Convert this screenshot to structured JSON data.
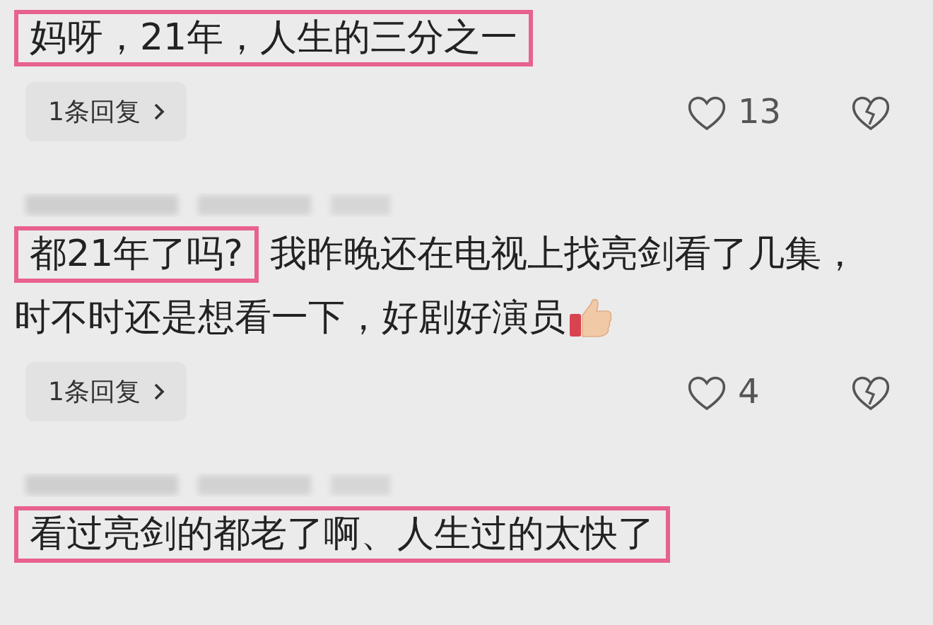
{
  "comments": [
    {
      "author_blurred": false,
      "segments": [
        {
          "text": "妈呀，21年，人生的三分之一",
          "highlighted": true
        }
      ],
      "replies": "1条回复",
      "likes": "13"
    },
    {
      "author_blurred": true,
      "segments": [
        {
          "text": "都21年了吗?",
          "highlighted": true
        },
        {
          "text": " 我昨晚还在电视上找亮剑看了几集，时不时还是想看一下，好剧好演员",
          "highlighted": false
        }
      ],
      "thumbs_up": true,
      "replies": "1条回复",
      "likes": "4"
    },
    {
      "author_blurred": true,
      "segments": [
        {
          "text": "看过亮剑的都老了啊、人生过的太快了",
          "highlighted": true
        }
      ]
    }
  ]
}
